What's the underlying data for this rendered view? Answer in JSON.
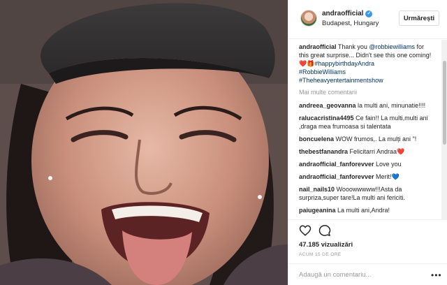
{
  "post": {
    "username": "andraofficial",
    "verified_glyph": "✓",
    "location": "Budapest, Hungary",
    "follow_label": "Urmărești",
    "caption": {
      "user": "andraofficial",
      "text_1": " Thank you ",
      "mention": "@robbiewilliams",
      "text_2": " for this great surprise... Didn't see this one coming! ",
      "emoji": "❤️🎁",
      "hashtag_1": "#happybirthdayAndra",
      "hashtag_2": "#RobbieWilliams",
      "hashtag_3": "#Theheavyentertainmentshow"
    },
    "more_comments_label": "Mai multe comentarii",
    "comments": [
      {
        "user": "andreea_geovanna",
        "text": " la multi ani, minunatie!!!!"
      },
      {
        "user": "ralucacristina4495",
        "text": " Ce fain!! La multi,multi ani ,draga mea frumoasa si talentata"
      },
      {
        "user": "boncuelena",
        "text": " WOW frumos,. La mulți ani \"!"
      },
      {
        "user": "thebestfanandra",
        "text": " Felicitarri Andraa❤️"
      },
      {
        "user": "andraofficial_fanforevver",
        "text": " Love you"
      },
      {
        "user": "andraofficial_fanforevver",
        "text": " Merit!💙"
      },
      {
        "user": "nail_nails10",
        "text": " Wooowwwww!!!Asta da surpriza,super tare!La multi ani fericiti."
      },
      {
        "user": "paiugeanina",
        "text": " La multi ani,Andra!"
      }
    ],
    "views": "47.185 vizualizări",
    "time": "ACUM 15 DE ORE",
    "add_comment_placeholder": "Adaugă un comentariu...",
    "more_options": "•••"
  },
  "icons": {
    "like": "heart-icon",
    "comment": "comment-icon",
    "verified": "verified-badge-icon",
    "options": "more-options-icon"
  },
  "colors": {
    "link": "#003569",
    "verified": "#3897f0",
    "muted": "#999999",
    "border": "#efefef"
  }
}
